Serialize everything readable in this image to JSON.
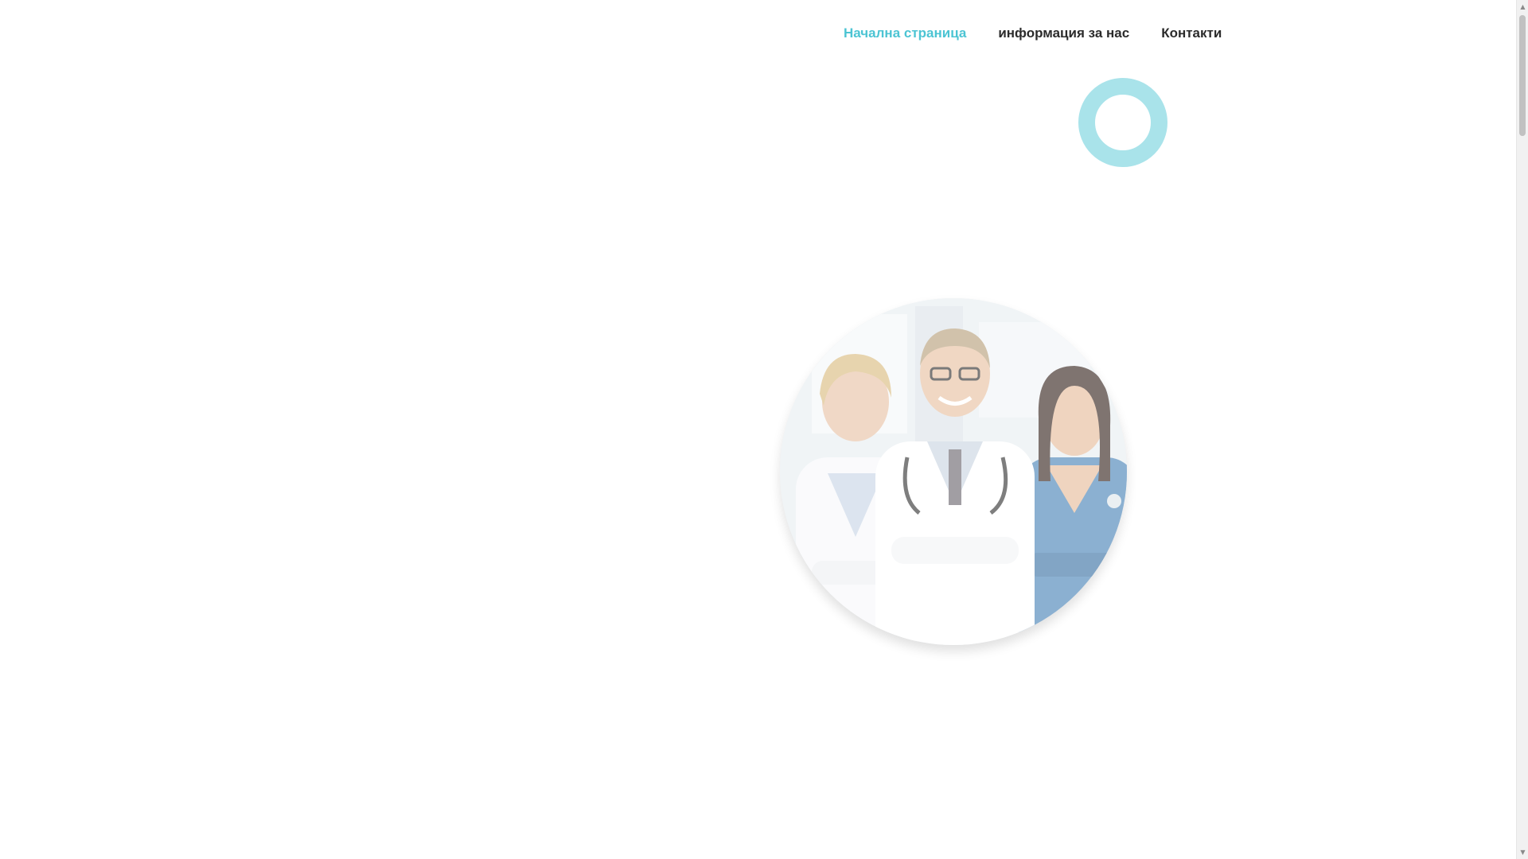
{
  "nav": {
    "items": [
      {
        "label": "Начална страница",
        "active": true
      },
      {
        "label": "информация за нас",
        "active": false
      },
      {
        "label": "Контакти",
        "active": false
      }
    ]
  },
  "colors": {
    "accent": "#4cc4d3",
    "ring": "#a9e3ea",
    "nav_text": "#2b2b2b"
  },
  "hero": {
    "image": "doctors-team-photo"
  },
  "scrollbar": {
    "up_icon": "▲",
    "down_icon": "▼"
  }
}
